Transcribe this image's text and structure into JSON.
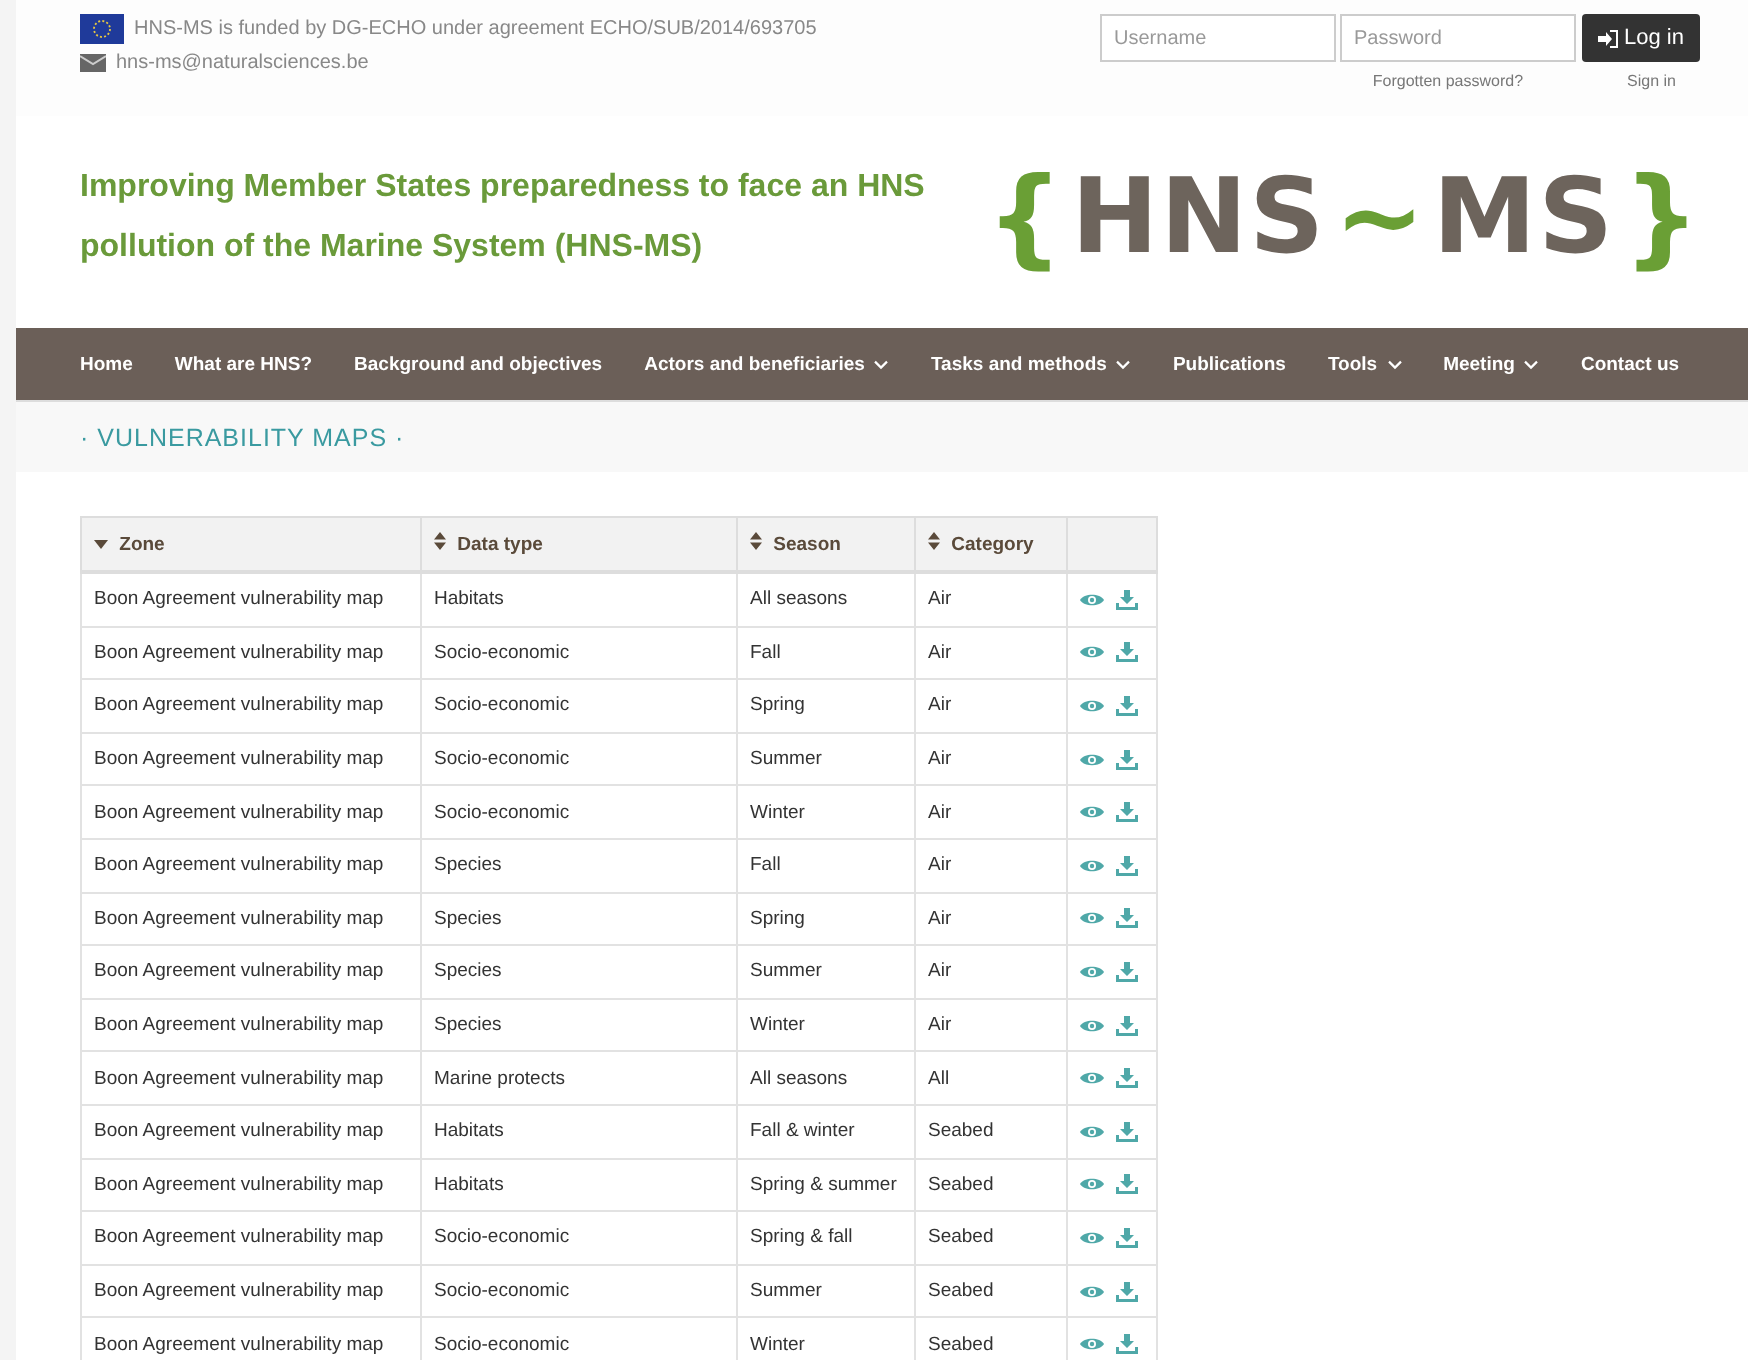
{
  "topbar": {
    "funding": "HNS-MS is funded by DG-ECHO under agreement ECHO/SUB/2014/693705",
    "email": "hns-ms@naturalsciences.be"
  },
  "login": {
    "username_placeholder": "Username",
    "password_placeholder": "Password",
    "button": "Log in",
    "forgot": "Forgotten password?",
    "signin": "Sign in"
  },
  "header": {
    "title": "Improving Member States preparedness to face an HNS pollution of the Marine System (HNS-MS)",
    "logo": [
      {
        "text": "{",
        "kind": "accent"
      },
      {
        "text": "HNS",
        "kind": "word"
      },
      {
        "text": "~",
        "kind": "accent"
      },
      {
        "text": "MS",
        "kind": "word"
      },
      {
        "text": "}",
        "kind": "accent"
      }
    ]
  },
  "nav": [
    {
      "label": "Home",
      "dropdown": false
    },
    {
      "label": "What are HNS?",
      "dropdown": false
    },
    {
      "label": "Background and objectives",
      "dropdown": false
    },
    {
      "label": "Actors and beneficiaries",
      "dropdown": true
    },
    {
      "label": "Tasks and methods",
      "dropdown": true
    },
    {
      "label": "Publications",
      "dropdown": false
    },
    {
      "label": "Tools",
      "dropdown": true
    },
    {
      "label": "Meeting",
      "dropdown": true
    },
    {
      "label": "Contact us",
      "dropdown": false
    }
  ],
  "page_title": "· VULNERABILITY MAPS ·",
  "table": {
    "columns": [
      {
        "label": "Zone",
        "sorted": true
      },
      {
        "label": "Data type",
        "sorted": false
      },
      {
        "label": "Season",
        "sorted": false
      },
      {
        "label": "Category",
        "sorted": false
      }
    ],
    "rows": [
      [
        "Boon Agreement vulnerability map",
        "Habitats",
        "All seasons",
        "Air"
      ],
      [
        "Boon Agreement vulnerability map",
        "Socio-economic",
        "Fall",
        "Air"
      ],
      [
        "Boon Agreement vulnerability map",
        "Socio-economic",
        "Spring",
        "Air"
      ],
      [
        "Boon Agreement vulnerability map",
        "Socio-economic",
        "Summer",
        "Air"
      ],
      [
        "Boon Agreement vulnerability map",
        "Socio-economic",
        "Winter",
        "Air"
      ],
      [
        "Boon Agreement vulnerability map",
        "Species",
        "Fall",
        "Air"
      ],
      [
        "Boon Agreement vulnerability map",
        "Species",
        "Spring",
        "Air"
      ],
      [
        "Boon Agreement vulnerability map",
        "Species",
        "Summer",
        "Air"
      ],
      [
        "Boon Agreement vulnerability map",
        "Species",
        "Winter",
        "Air"
      ],
      [
        "Boon Agreement vulnerability map",
        "Marine protects",
        "All seasons",
        "All"
      ],
      [
        "Boon Agreement vulnerability map",
        "Habitats",
        "Fall & winter",
        "Seabed"
      ],
      [
        "Boon Agreement vulnerability map",
        "Habitats",
        "Spring & summer",
        "Seabed"
      ],
      [
        "Boon Agreement vulnerability map",
        "Socio-economic",
        "Spring & fall",
        "Seabed"
      ],
      [
        "Boon Agreement vulnerability map",
        "Socio-economic",
        "Summer",
        "Seabed"
      ],
      [
        "Boon Agreement vulnerability map",
        "Socio-economic",
        "Winter",
        "Seabed"
      ]
    ]
  }
}
